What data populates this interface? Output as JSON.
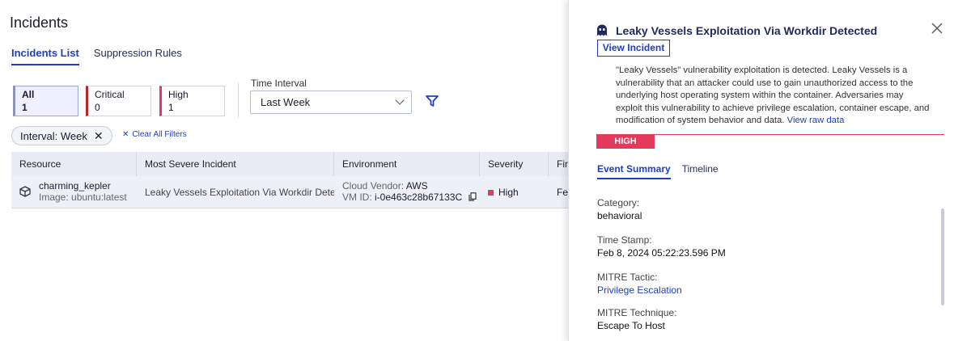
{
  "page": {
    "title": "Incidents"
  },
  "tabs": [
    {
      "label": "Incidents List",
      "active": true
    },
    {
      "label": "Suppression Rules",
      "active": false
    }
  ],
  "filters": {
    "cards": [
      {
        "label": "All",
        "count": "1"
      },
      {
        "label": "Critical",
        "count": "0"
      },
      {
        "label": "High",
        "count": "1"
      }
    ],
    "time_interval_label": "Time Interval",
    "time_interval_value": "Last Week",
    "chip_label": "Interval: Week",
    "clear_all": "Clear All Filters"
  },
  "table": {
    "headers": [
      "Resource",
      "Most Severe Incident",
      "Environment",
      "Severity",
      "Fir"
    ],
    "rows": [
      {
        "resource_name": "charming_kepler",
        "resource_image": "Image: ubuntu:latest",
        "incident": "Leaky Vessels Exploitation Via Workdir Dete...",
        "env_vendor_label": "Cloud Vendor:",
        "env_vendor_value": "AWS",
        "env_vm_label": "VM ID:",
        "env_vm_value": "i-0e463c28b67133C",
        "severity": "High",
        "first": "Feb"
      }
    ]
  },
  "drawer": {
    "title": "Leaky Vessels Exploitation Via Workdir Detected",
    "view_button": "View Incident",
    "description": "\"Leaky Vessels\" vulnerability exploitation is detected. Leaky Vessels is a vulnerability that an attacker could use to gain unauthorized access to the underlying host operating system within the container. Adversaries may exploit this vulnerability to achieve privilege escalation, container escape, and modification of system behavior and data.",
    "raw_link": "View raw data",
    "severity_badge": "HIGH",
    "tabs": [
      {
        "label": "Event Summary",
        "active": true
      },
      {
        "label": "Timeline",
        "active": false
      }
    ],
    "fields": [
      {
        "label": "Category:",
        "value": "behavioral",
        "link": false
      },
      {
        "label": "Time Stamp:",
        "value": "Feb 8, 2024 05:22:23.596 PM",
        "link": false
      },
      {
        "label": "MITRE Tactic:",
        "value": "Privilege Escalation",
        "link": true
      },
      {
        "label": "MITRE Technique:",
        "value": "Escape To Host",
        "link": false
      }
    ]
  },
  "colors": {
    "accent": "#1f3fbf",
    "high": "#e4395a",
    "critical": "#b3262b"
  }
}
